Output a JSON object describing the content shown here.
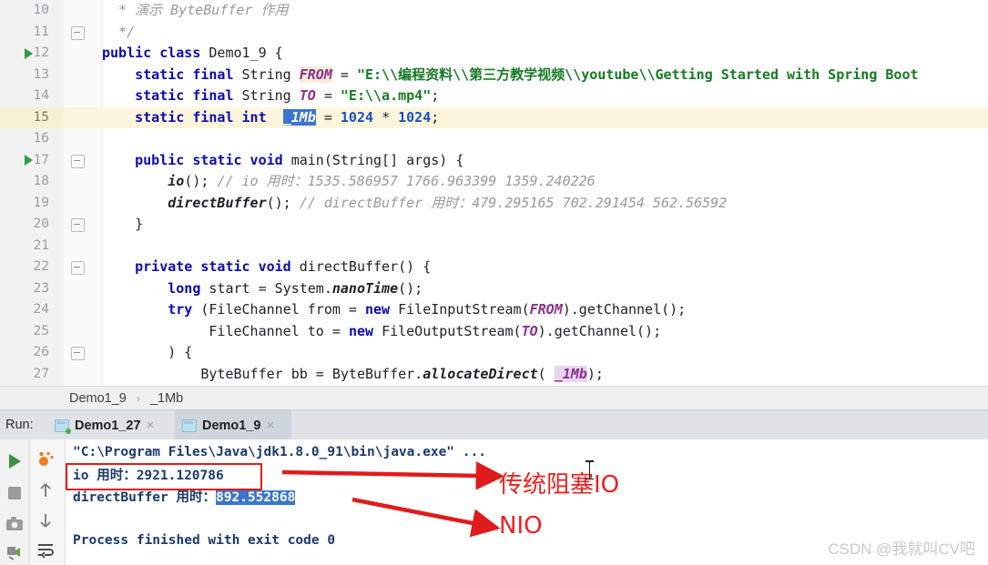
{
  "editor": {
    "first_line": 10,
    "highlighted_line": 15,
    "lines": [
      {
        "n": 10,
        "indent": 0,
        "text": "  * 演示 ByteBuffer 作用"
      },
      {
        "n": 11,
        "indent": 0,
        "text": "  */"
      },
      {
        "n": 12,
        "indent": 0,
        "text": "public class Demo1_9 {"
      },
      {
        "n": 13,
        "indent": 0,
        "text": "    static final String FROM = \"E:\\\\编程资料\\\\第三方教学视频\\\\youtube\\\\Getting Started with Spring Boot"
      },
      {
        "n": 14,
        "indent": 0,
        "text": "    static final String TO = \"E:\\\\a.mp4\";"
      },
      {
        "n": 15,
        "indent": 0,
        "text": "    static final int _1Mb = 1024 * 1024;"
      },
      {
        "n": 16,
        "indent": 0,
        "text": ""
      },
      {
        "n": 17,
        "indent": 0,
        "text": "    public static void main(String[] args) {"
      },
      {
        "n": 18,
        "indent": 0,
        "text": "        io(); // io 用时：1535.586957 1766.963399 1359.240226"
      },
      {
        "n": 19,
        "indent": 0,
        "text": "        directBuffer(); // directBuffer 用时：479.295165 702.291454 562.56592"
      },
      {
        "n": 20,
        "indent": 0,
        "text": "    }"
      },
      {
        "n": 21,
        "indent": 0,
        "text": ""
      },
      {
        "n": 22,
        "indent": 0,
        "text": "    private static void directBuffer() {"
      },
      {
        "n": 23,
        "indent": 0,
        "text": "        long start = System.nanoTime();"
      },
      {
        "n": 24,
        "indent": 0,
        "text": "        try (FileChannel from = new FileInputStream(FROM).getChannel();"
      },
      {
        "n": 25,
        "indent": 0,
        "text": "             FileChannel to = new FileOutputStream(TO).getChannel();"
      },
      {
        "n": 26,
        "indent": 0,
        "text": "        ) {"
      },
      {
        "n": 27,
        "indent": 0,
        "text": "            ByteBuffer bb = ByteBuffer.allocateDirect(_1Mb);"
      }
    ],
    "run_marker_lines": [
      12,
      17
    ],
    "fold_marker_lines": [
      11,
      17,
      20,
      22,
      26
    ]
  },
  "breadcrumb": {
    "items": [
      "Demo1_9",
      "_1Mb"
    ],
    "separator": "›"
  },
  "run_window": {
    "label": "Run:",
    "tabs": [
      {
        "label": "Demo1_27",
        "active": false,
        "running": true,
        "close": "×",
        "icon": "run-config-icon"
      },
      {
        "label": "Demo1_9",
        "active": true,
        "running": false,
        "close": "×",
        "icon": "run-config-icon"
      }
    ],
    "left_toolbar": [
      {
        "name": "rerun-icon",
        "glyph": "▶"
      },
      {
        "name": "stop-icon",
        "glyph": "■"
      },
      {
        "name": "screenshot-icon",
        "glyph": "▣"
      },
      {
        "name": "print-icon",
        "glyph": "⚙"
      }
    ],
    "right_toolbar": [
      {
        "name": "coverage-icon",
        "glyph": "●"
      },
      {
        "name": "up-arrow-icon",
        "glyph": "↑"
      },
      {
        "name": "down-arrow-icon",
        "glyph": "↓"
      },
      {
        "name": "soft-wrap-icon",
        "glyph": "⏎"
      }
    ]
  },
  "console": {
    "lines": [
      {
        "text": "\"C:\\Program Files\\Java\\jdk1.8.0_91\\bin\\java.exe\" ...",
        "style": "plain"
      },
      {
        "text": "io 用时：2921.120786",
        "style": "plain",
        "boxed": true
      },
      {
        "text": "directBuffer 用时：",
        "style": "plain",
        "selected_suffix": "892.552868"
      },
      {
        "text": "",
        "style": "plain"
      },
      {
        "text": "Process finished with exit code 0",
        "style": "plain"
      }
    ]
  },
  "annotations": {
    "label_io": "传统阻塞IO",
    "label_nio": "NIO",
    "color": "#ef2020"
  },
  "watermark": {
    "text": "CSDN @我就叫CV吧"
  }
}
